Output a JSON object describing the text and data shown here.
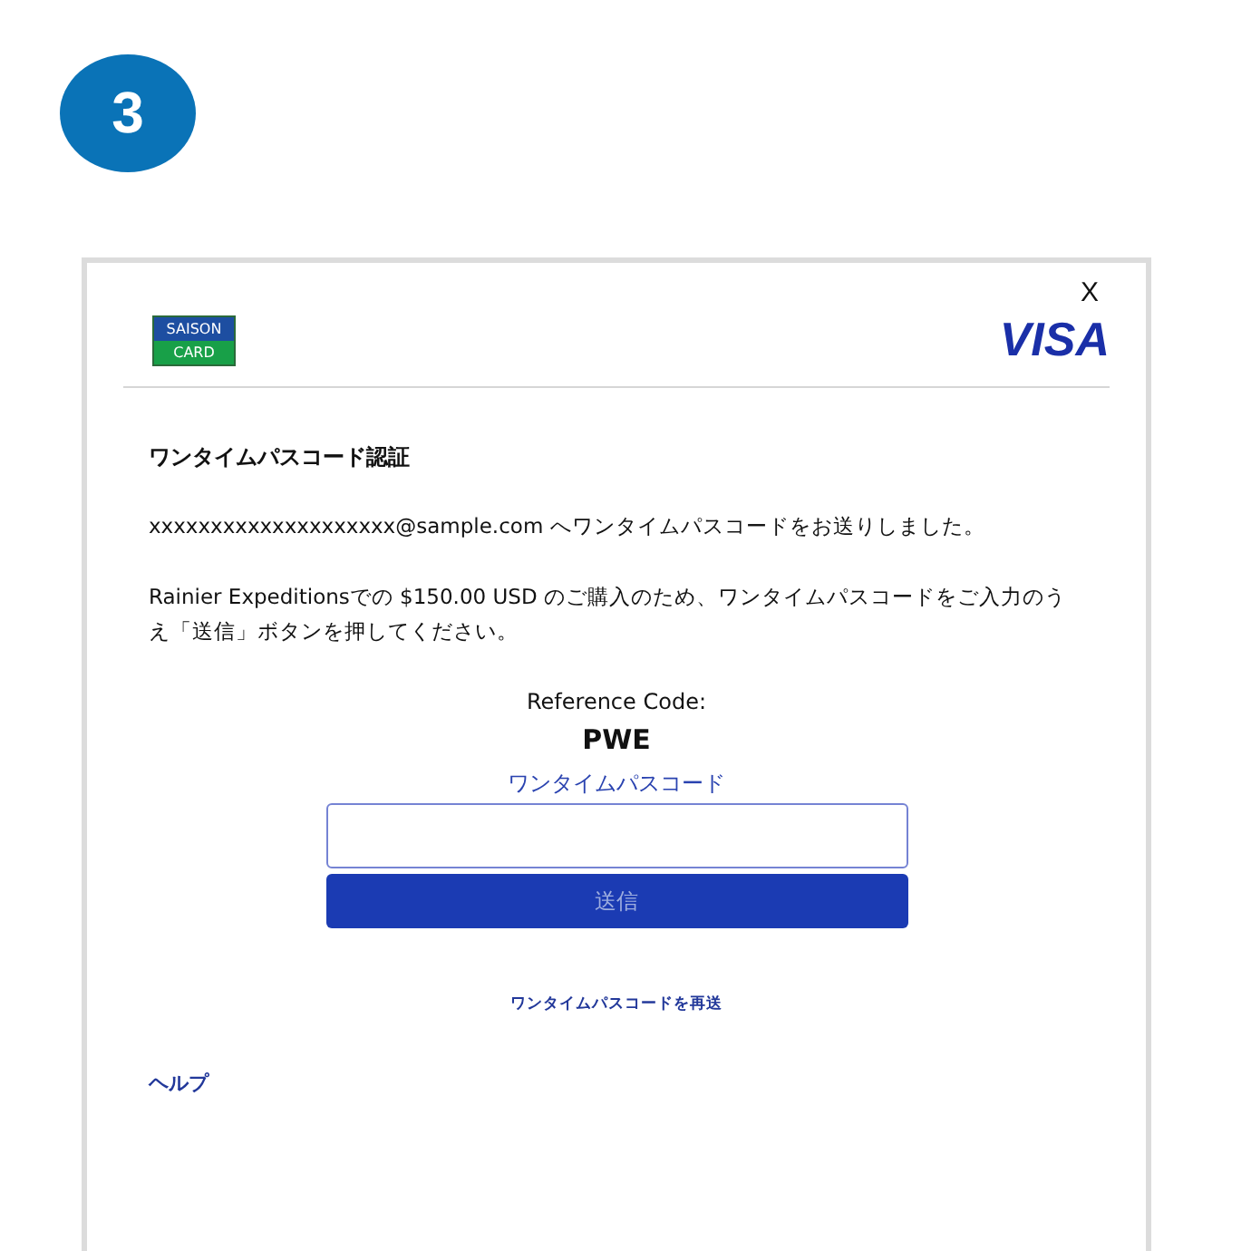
{
  "step": {
    "number": "3"
  },
  "dialog": {
    "close": "X",
    "issuer_logo": {
      "top": "SAISON",
      "bottom": "CARD"
    },
    "brand_logo": "VISA",
    "title": "ワンタイムパスコード認証",
    "messages": [
      "xxxxxxxxxxxxxxxxxxxx@sample.com へワンタイムパスコードをお送りしました。",
      "Rainier Expeditionsでの $150.00 USD のご購入のため、ワンタイムパスコードをご入力のうえ「送信」ボタンを押してください。"
    ],
    "reference_label": "Reference Code:",
    "reference_code": "PWE",
    "field_label": "ワンタイムパスコード",
    "submit": {
      "label": "送信",
      "disabled": true
    },
    "resend_link": "ワンタイムパスコードを再送",
    "help_link": "ヘルプ"
  }
}
